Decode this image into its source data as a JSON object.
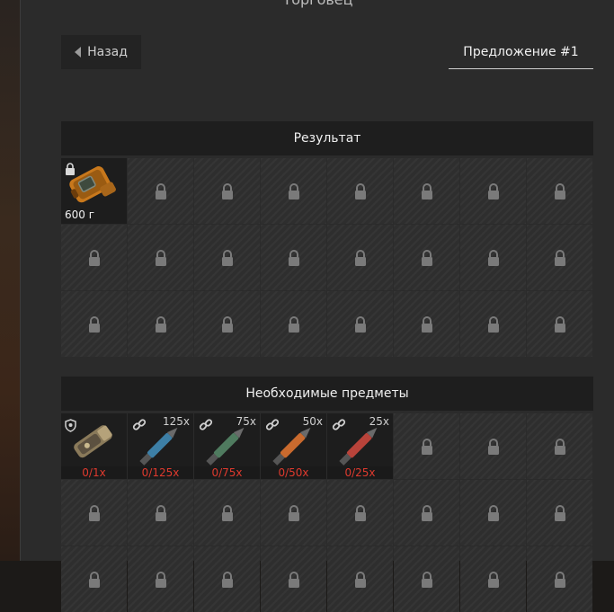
{
  "window": {
    "title": "Торговец"
  },
  "toolbar": {
    "back_label": "Назад",
    "offer_tab_label": "Предложение #1"
  },
  "result": {
    "title": "Результат",
    "item": {
      "name": "device-icon",
      "price_label": "600 г",
      "locked": true
    },
    "locked_slots": 23
  },
  "required": {
    "title": "Необходимые предметы",
    "items": [
      {
        "icon": "tool-icon",
        "count": "",
        "requirement": "0/1x"
      },
      {
        "icon": "blue-ammo-icon",
        "count": "125x",
        "requirement": "0/125x"
      },
      {
        "icon": "green-ammo-icon",
        "count": "75x",
        "requirement": "0/75x"
      },
      {
        "icon": "orange-ammo-icon",
        "count": "50x",
        "requirement": "0/50x"
      },
      {
        "icon": "red-ammo-icon",
        "count": "25x",
        "requirement": "0/25x"
      }
    ]
  },
  "colors": {
    "requirement_text": "#e03a2e",
    "panel_bg": "#2b2b2b",
    "header_bg": "#1e1e1e",
    "ammo_blue": "#3d7fa6",
    "ammo_green": "#4f7b5f",
    "ammo_orange": "#c96a2e",
    "ammo_red": "#b8433a"
  }
}
